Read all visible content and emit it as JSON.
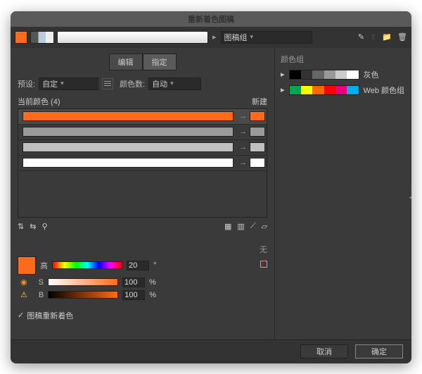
{
  "title": "重新着色图稿",
  "toolbar": {
    "group_dd": "图稿组"
  },
  "tabs": {
    "edit": "编辑",
    "assign": "指定"
  },
  "preset": {
    "label": "预设:",
    "value": "自定",
    "count_label": "颜色数:",
    "count_value": "自动"
  },
  "colors": {
    "current_label": "当前颜色 (4)",
    "new_label": "新建",
    "rows": [
      {
        "bar": "#ff6b1a",
        "chip": "#ff6b1a",
        "sel": true
      },
      {
        "bar": "#9a9a9a",
        "chip": "#9a9a9a"
      },
      {
        "bar": "#c0c0c0",
        "chip": "#c0c0c0"
      },
      {
        "bar": "#ffffff",
        "chip": "#ffffff"
      }
    ]
  },
  "none_label": "无",
  "hsv": {
    "h_lbl": "高",
    "h": "20",
    "s_lbl": "S",
    "s": "100",
    "b_lbl": "B",
    "b": "100",
    "deg": "°",
    "pct": "%"
  },
  "checkbox": "图稿重新着色",
  "groups": {
    "header": "颜色组",
    "gray": "灰色",
    "web": "Web 颜色组"
  },
  "footer": {
    "cancel": "取消",
    "ok": "确定"
  }
}
